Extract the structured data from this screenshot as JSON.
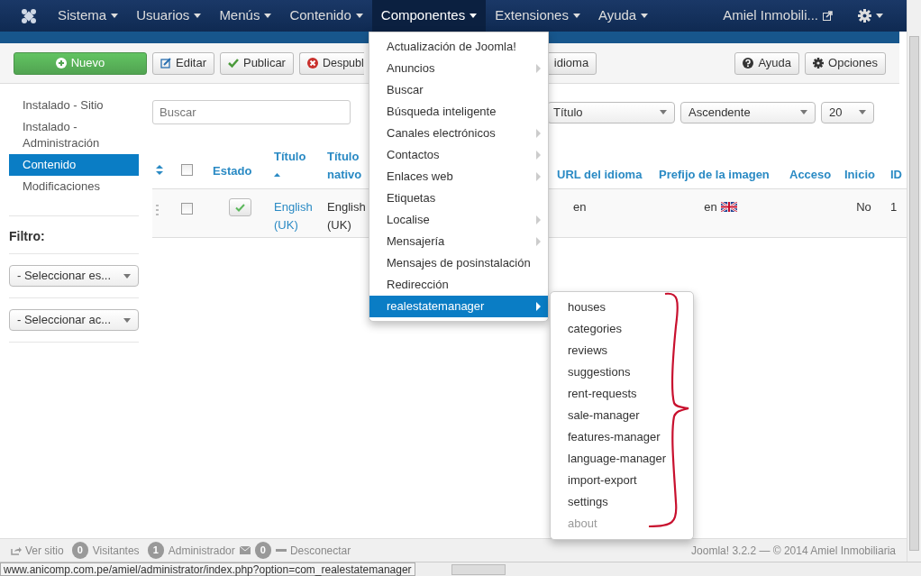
{
  "navbar": {
    "menus": [
      {
        "label": "Sistema",
        "selected": false
      },
      {
        "label": "Usuarios",
        "selected": false
      },
      {
        "label": "Menús",
        "selected": false
      },
      {
        "label": "Contenido",
        "selected": false
      },
      {
        "label": "Componentes",
        "selected": true
      },
      {
        "label": "Extensiones",
        "selected": false
      },
      {
        "label": "Ayuda",
        "selected": false
      }
    ],
    "user": "Amiel Inmobili..."
  },
  "toolbar": {
    "buttons": [
      {
        "label": "Nuevo",
        "kind": "new"
      },
      {
        "label": "Editar",
        "kind": "edit"
      },
      {
        "label": "Publicar",
        "kind": "publish"
      },
      {
        "label": "Despubl",
        "kind": "unpublish"
      },
      {
        "label": "idioma",
        "kind": "plain"
      }
    ],
    "right_buttons": [
      {
        "label": "Ayuda",
        "kind": "help"
      },
      {
        "label": "Opciones",
        "kind": "options"
      }
    ]
  },
  "sidebar": {
    "items": [
      {
        "label": "Instalado - Sitio",
        "selected": false
      },
      {
        "label": "Instalado - Administración",
        "selected": false
      },
      {
        "label": "Contenido",
        "selected": true
      },
      {
        "label": "Modificaciones",
        "selected": false
      }
    ],
    "filter_title": "Filtro:",
    "filters": [
      {
        "value": "- Seleccionar es..."
      },
      {
        "value": "- Seleccionar ac..."
      }
    ]
  },
  "search": {
    "placeholder": "Buscar"
  },
  "sort": {
    "order_by": "Título",
    "direction": "Ascendente",
    "limit": "20"
  },
  "table": {
    "columns": [
      {
        "kind": "ordering"
      },
      {
        "kind": "checkbox",
        "checked": false
      },
      {
        "kind": "text",
        "label": "Estado",
        "sorted": false
      },
      {
        "kind": "text",
        "label": "Título",
        "sorted": true
      },
      {
        "kind": "text",
        "label": "Título nativo",
        "sorted": false
      },
      {
        "kind": "text",
        "label": "URL del idioma",
        "sorted": false
      },
      {
        "kind": "text",
        "label": "Prefijo de la imagen",
        "sorted": false
      },
      {
        "kind": "text",
        "label": "Acceso",
        "sorted": false
      },
      {
        "kind": "text",
        "label": "Inicio",
        "sorted": false
      },
      {
        "kind": "text",
        "label": "ID",
        "sorted": false
      }
    ],
    "rows": [
      {
        "checked": false,
        "published": true,
        "title": "English (UK)",
        "native": "English (UK)",
        "url": "en",
        "image_prefix": "en",
        "home": "No",
        "id": "1"
      }
    ]
  },
  "menu": {
    "items": [
      {
        "label": "Actualización de Joomla!",
        "submenu": false,
        "selected": false
      },
      {
        "label": "Anuncios",
        "submenu": true,
        "selected": false
      },
      {
        "label": "Buscar",
        "submenu": false,
        "selected": false
      },
      {
        "label": "Búsqueda inteligente",
        "submenu": false,
        "selected": false
      },
      {
        "label": "Canales electrónicos",
        "submenu": true,
        "selected": false
      },
      {
        "label": "Contactos",
        "submenu": true,
        "selected": false
      },
      {
        "label": "Enlaces web",
        "submenu": true,
        "selected": false
      },
      {
        "label": "Etiquetas",
        "submenu": false,
        "selected": false
      },
      {
        "label": "Localise",
        "submenu": true,
        "selected": false
      },
      {
        "label": "Mensajería",
        "submenu": true,
        "selected": false
      },
      {
        "label": "Mensajes de posinstalación",
        "submenu": false,
        "selected": false
      },
      {
        "label": "Redirección",
        "submenu": false,
        "selected": false
      },
      {
        "label": "realestatemanager",
        "submenu": true,
        "selected": true
      }
    ],
    "submenu": {
      "items": [
        {
          "label": "houses",
          "disabled": false
        },
        {
          "label": "categories",
          "disabled": false
        },
        {
          "label": "reviews",
          "disabled": false
        },
        {
          "label": "suggestions",
          "disabled": false
        },
        {
          "label": "rent-requests",
          "disabled": false
        },
        {
          "label": "sale-manager",
          "disabled": false
        },
        {
          "label": "features-manager",
          "disabled": false
        },
        {
          "label": "language-manager",
          "disabled": false
        },
        {
          "label": "import-export",
          "disabled": false
        },
        {
          "label": "settings",
          "disabled": false
        },
        {
          "label": "about",
          "disabled": true
        }
      ]
    }
  },
  "status_bar": {
    "view_site": "Ver sitio",
    "visitors_count": "0",
    "visitors": "Visitantes",
    "admins_count": "1",
    "admins": "Administrador",
    "messages_count": "0",
    "logout": "Desconectar",
    "version": "Joomla! 3.2.2 — © 2014 Amiel Inmobiliaria"
  },
  "link_hint": "www.anicomp.com.pe/amiel/administrator/index.php?option=com_realestatemanager"
}
